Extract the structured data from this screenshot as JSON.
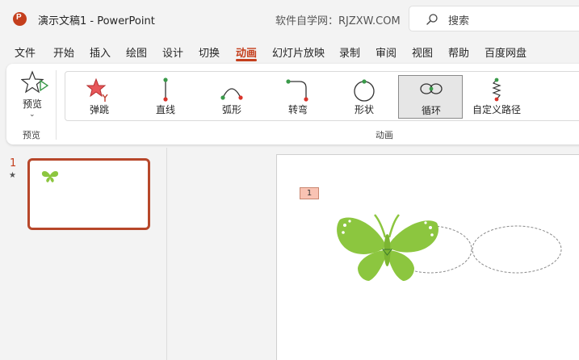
{
  "titlebar": {
    "document_title": "演示文稿1  -  PowerPoint",
    "site_watermark": "软件自学网：RJZXW.COM",
    "search_label": "搜索"
  },
  "tabs": [
    "文件",
    "开始",
    "插入",
    "绘图",
    "设计",
    "切换",
    "动画",
    "幻灯片放映",
    "录制",
    "审阅",
    "视图",
    "帮助",
    "百度网盘"
  ],
  "active_tab": "动画",
  "ribbon": {
    "preview_button": "预览",
    "preview_group": "预览",
    "animation_group": "动画",
    "animations": [
      "弹跳",
      "直线",
      "弧形",
      "转弯",
      "形状",
      "循环",
      "自定义路径"
    ],
    "selected_animation": "循环"
  },
  "slides_pane": {
    "slide_number": "1",
    "transition_mark": "★"
  },
  "slide": {
    "animation_tag": "1"
  },
  "colors": {
    "accent": "#c43e1c",
    "butterfly": "#8cc63f",
    "thumb_border": "#b7472a"
  }
}
